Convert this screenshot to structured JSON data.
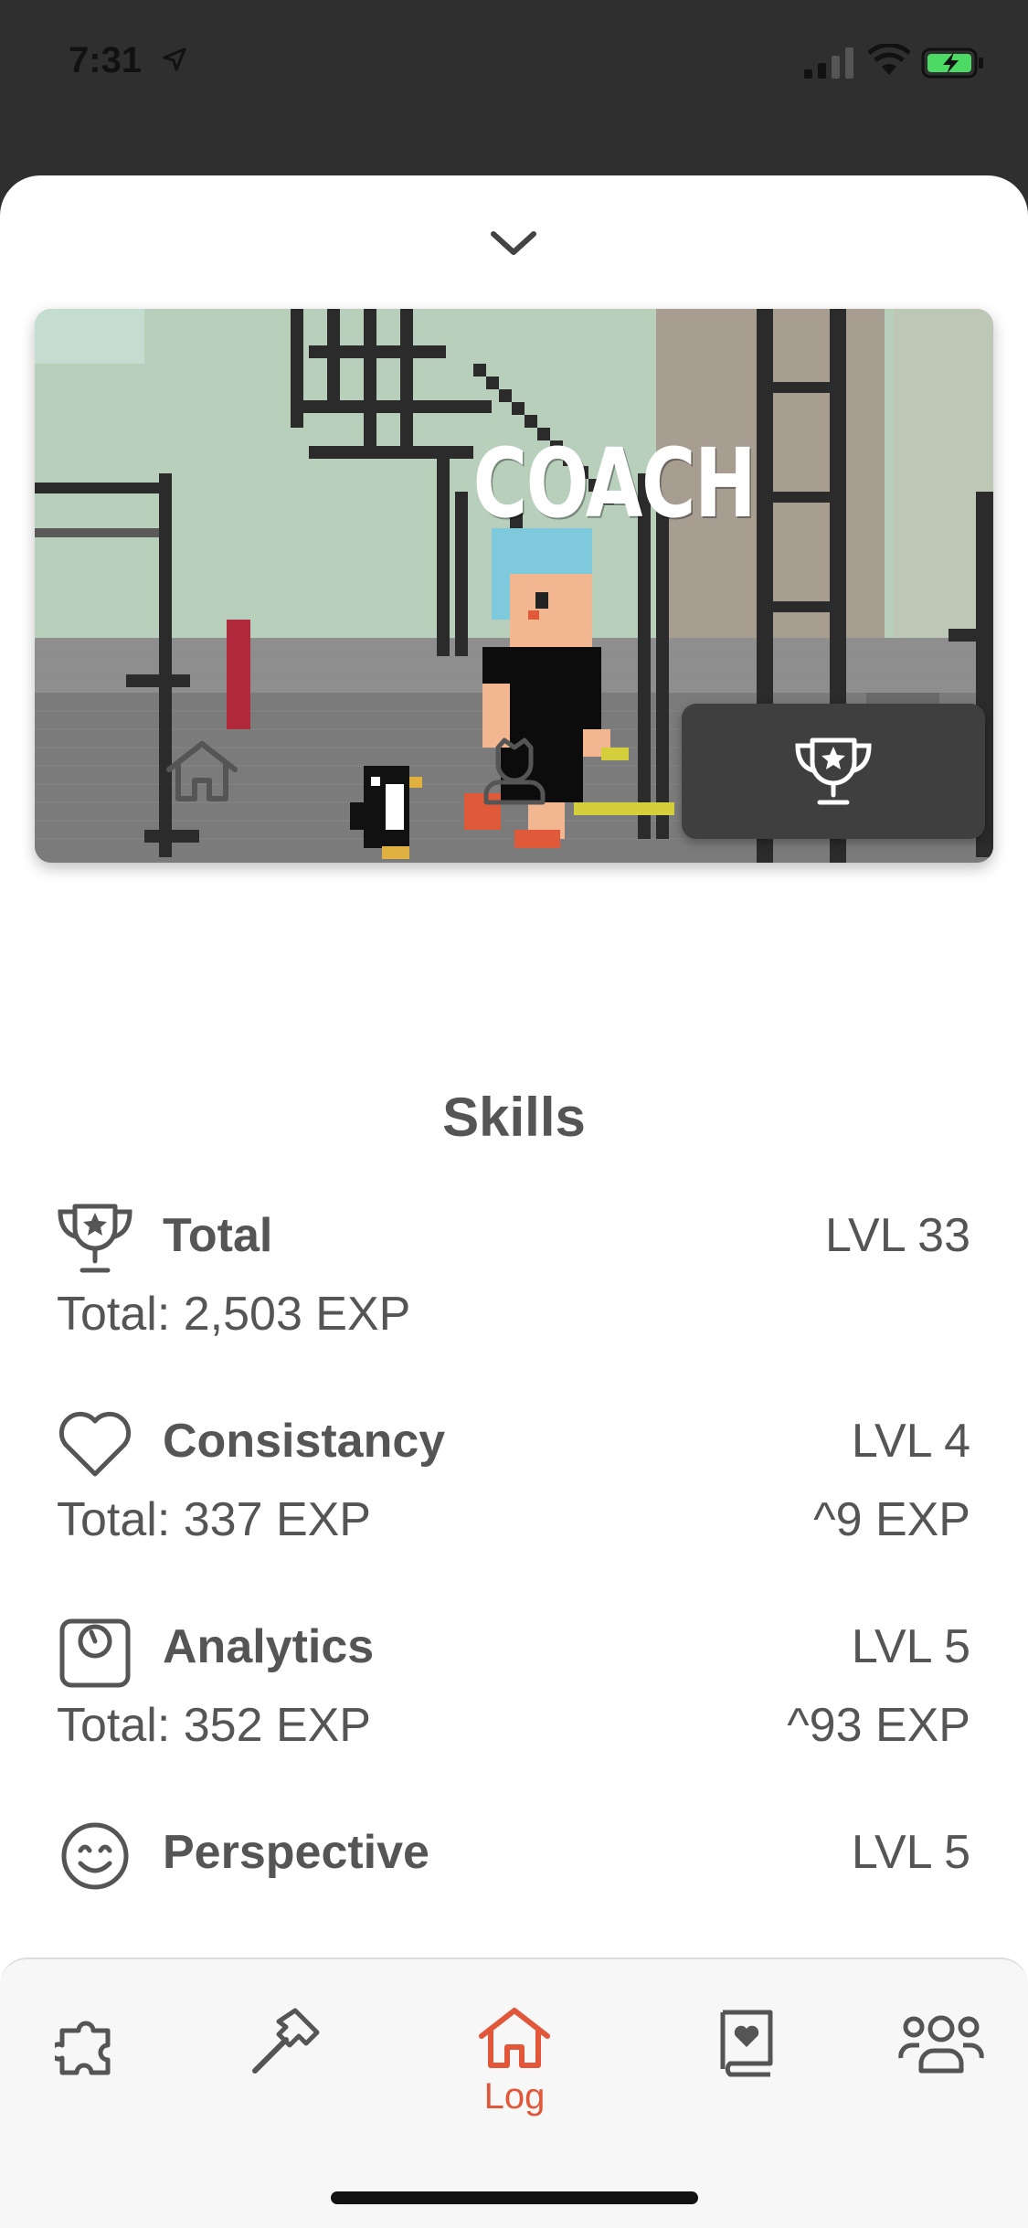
{
  "status_bar": {
    "time": "7:31"
  },
  "hero": {
    "title": "COACH"
  },
  "tabs": [
    {
      "icon": "home-icon",
      "active": false
    },
    {
      "icon": "profile-icon",
      "active": false
    },
    {
      "icon": "trophy-icon",
      "active": true
    }
  ],
  "section_title": "Skills",
  "skills": [
    {
      "name": "Total",
      "level": "LVL 33",
      "total": "Total: 2,503 EXP",
      "next": "",
      "icon": "trophy-icon"
    },
    {
      "name": "Consistancy",
      "level": "LVL 4",
      "total": "Total: 337 EXP",
      "next": "^9 EXP",
      "icon": "heart-icon"
    },
    {
      "name": "Analytics",
      "level": "LVL 5",
      "total": "Total: 352 EXP",
      "next": "^93 EXP",
      "icon": "scale-icon"
    },
    {
      "name": "Perspective",
      "level": "LVL 5",
      "total": "",
      "next": "",
      "icon": "smile-icon"
    }
  ],
  "bottom_nav": {
    "items": [
      {
        "icon": "puzzle-icon",
        "label": ""
      },
      {
        "icon": "hammer-icon",
        "label": ""
      },
      {
        "icon": "home-icon",
        "label": "Log",
        "active": true
      },
      {
        "icon": "book-heart-icon",
        "label": ""
      },
      {
        "icon": "group-icon",
        "label": ""
      }
    ]
  },
  "colors": {
    "accent": "#e2573a",
    "text": "#555555",
    "active_tab_bg": "#3f3f3f"
  }
}
